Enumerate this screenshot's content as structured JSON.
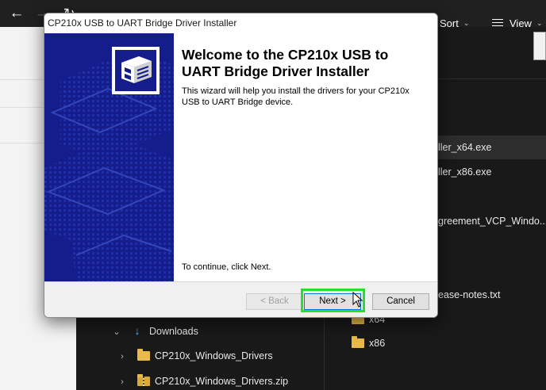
{
  "explorer": {
    "nav": {
      "back": "←",
      "forward": "→",
      "refresh": "↻"
    },
    "toolbar": {
      "sort": "Sort",
      "view": "View"
    },
    "files": [
      {
        "name": "ller_x64.exe",
        "selected": true
      },
      {
        "name": "ller_x86.exe",
        "selected": false
      },
      {
        "name": "greement_VCP_Windo...",
        "selected": false
      },
      {
        "name": "ease-notes.txt",
        "selected": false
      },
      {
        "name": "x64",
        "selected": false
      },
      {
        "name": "x86",
        "selected": false
      }
    ],
    "tree": [
      {
        "label": "Downloads",
        "chevron": "⌄"
      },
      {
        "label": "CP210x_Windows_Drivers",
        "chevron": "›"
      },
      {
        "label": "CP210x_Windows_Drivers.zip",
        "chevron": "›"
      }
    ]
  },
  "dialog": {
    "title": "CP210x USB to UART Bridge Driver Installer",
    "heading": "Welcome to the CP210x USB to UART Bridge Driver Installer",
    "description": "This wizard will help you install the drivers for your CP210x USB to UART Bridge device.",
    "continue_text": "To continue, click Next.",
    "buttons": {
      "back": "< Back",
      "next": "Next >",
      "cancel": "Cancel"
    }
  },
  "colors": {
    "banner": "#151d8d",
    "highlight": "#25e12d",
    "explorer_bg": "#191919"
  }
}
